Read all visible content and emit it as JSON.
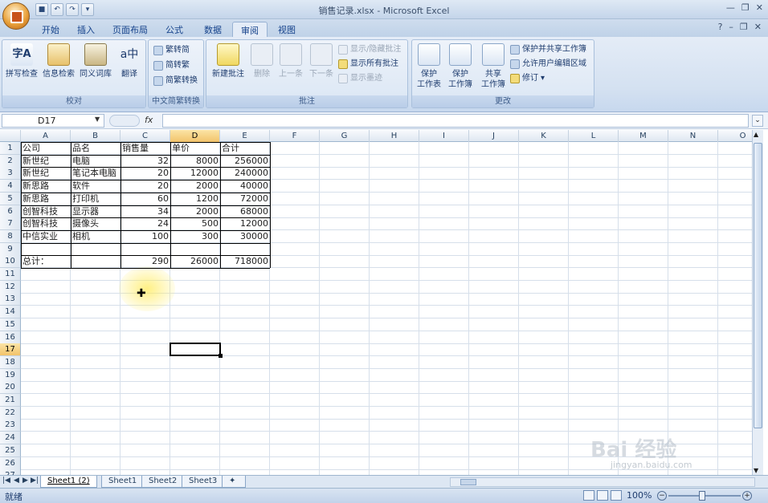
{
  "window": {
    "title": "销售记录.xlsx - Microsoft Excel"
  },
  "tabs": [
    "开始",
    "插入",
    "页面布局",
    "公式",
    "数据",
    "审阅",
    "视图"
  ],
  "active_tab": "审阅",
  "ribbon": {
    "proofing": {
      "label": "校对",
      "buttons": [
        "拼写检查",
        "信息检索",
        "同义词库",
        "翻译"
      ]
    },
    "chinese": {
      "label": "中文简繁转换",
      "buttons": [
        "繁转简",
        "简转繁",
        "简繁转换"
      ]
    },
    "comments": {
      "label": "批注",
      "buttons": [
        "新建批注",
        "删除",
        "上一条",
        "下一条"
      ],
      "small": [
        "显示/隐藏批注",
        "显示所有批注",
        "显示墨迹"
      ]
    },
    "changes": {
      "label": "更改",
      "buttons": [
        "保护工作表",
        "保护工作簿",
        "共享工作簿"
      ],
      "btn_lines": [
        [
          "保护",
          "工作表"
        ],
        [
          "保护",
          "工作簿"
        ],
        [
          "共享",
          "工作簿"
        ]
      ],
      "small": [
        "保护并共享工作簿",
        "允许用户编辑区域",
        "修订"
      ]
    }
  },
  "namebox": "D17",
  "fx": "fx",
  "columns": [
    "A",
    "B",
    "C",
    "D",
    "E",
    "F",
    "G",
    "H",
    "I",
    "J",
    "K",
    "L",
    "M",
    "N",
    "O"
  ],
  "rows": [
    "1",
    "2",
    "3",
    "4",
    "5",
    "6",
    "7",
    "8",
    "9",
    "10",
    "11",
    "12",
    "13",
    "14",
    "15",
    "16",
    "17",
    "18",
    "19",
    "20",
    "21",
    "22",
    "23",
    "24",
    "25",
    "26",
    "27"
  ],
  "selected_col": "D",
  "selected_row": "17",
  "table": {
    "headers": [
      "公司",
      "品名",
      "销售量",
      "单价",
      "合计"
    ],
    "rows": [
      [
        "新世纪",
        "电脑",
        "32",
        "8000",
        "256000"
      ],
      [
        "新世纪",
        "笔记本电脑",
        "20",
        "12000",
        "240000"
      ],
      [
        "新思路",
        "软件",
        "20",
        "2000",
        "40000"
      ],
      [
        "新思路",
        "打印机",
        "60",
        "1200",
        "72000"
      ],
      [
        "创智科技",
        "显示器",
        "34",
        "2000",
        "68000"
      ],
      [
        "创智科技",
        "摄像头",
        "24",
        "500",
        "12000"
      ],
      [
        "中信实业",
        "相机",
        "100",
        "300",
        "30000"
      ],
      [
        "",
        "",
        "",
        "",
        ""
      ],
      [
        "总计：",
        "",
        "290",
        "26000",
        "718000"
      ]
    ]
  },
  "sheets": [
    "Sheet1 (2)",
    "Sheet1",
    "Sheet2",
    "Sheet3"
  ],
  "active_sheet": "Sheet1 (2)",
  "status": "就绪",
  "zoom": "100%",
  "watermark": {
    "line1": "Bai 经验",
    "line2": "jingyan.baidu.com"
  }
}
